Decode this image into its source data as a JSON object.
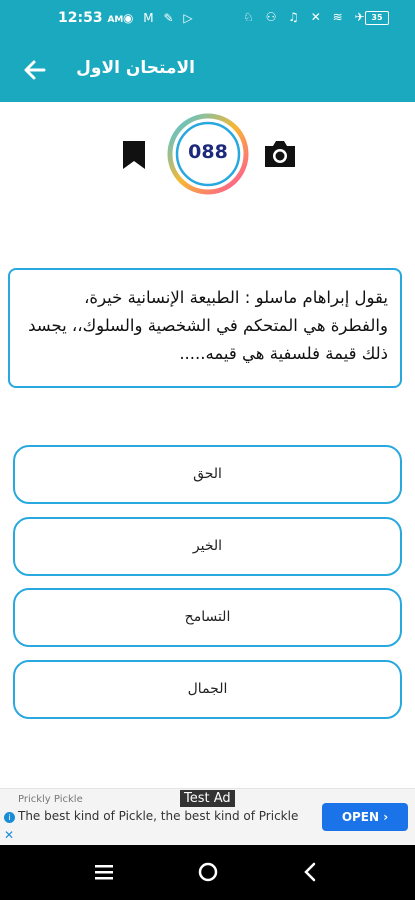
{
  "status": {
    "time": "12:53",
    "ampm": "AM",
    "battery": "35",
    "left_icons": "◉ M ✎ ▷",
    "right_icons": "♘ ⚇ ♫ ✕ ≋ ✈"
  },
  "header": {
    "title": "الامتحان الاول"
  },
  "counter": {
    "value": "088"
  },
  "question": {
    "text": "يقول إبراهام ماسلو : الطبيعة الإنسانية خيرة، والفطرة هي المتحكم في الشخصية والسلوك،، يجسد ذلك قيمة فلسفية هي قيمه....."
  },
  "options": [
    {
      "label": "الحق"
    },
    {
      "label": "الخير"
    },
    {
      "label": "التسامح"
    },
    {
      "label": "الجمال"
    }
  ],
  "ad": {
    "advertiser": "Prickly Pickle",
    "label": "Test Ad",
    "headline": "The best kind of Pickle, the best kind of Prickle",
    "cta": "OPEN ›",
    "info": "i",
    "close": "✕"
  },
  "colors": {
    "primary": "#1aa9bf",
    "border": "#29a8df",
    "counter_text": "#1d2a7a"
  },
  "icons": {
    "back": "arrow-left-icon",
    "bookmark": "bookmark-icon",
    "camera": "camera-icon",
    "nav_menu": "recents-icon",
    "nav_home": "home-icon",
    "nav_back": "chevron-left-icon"
  }
}
